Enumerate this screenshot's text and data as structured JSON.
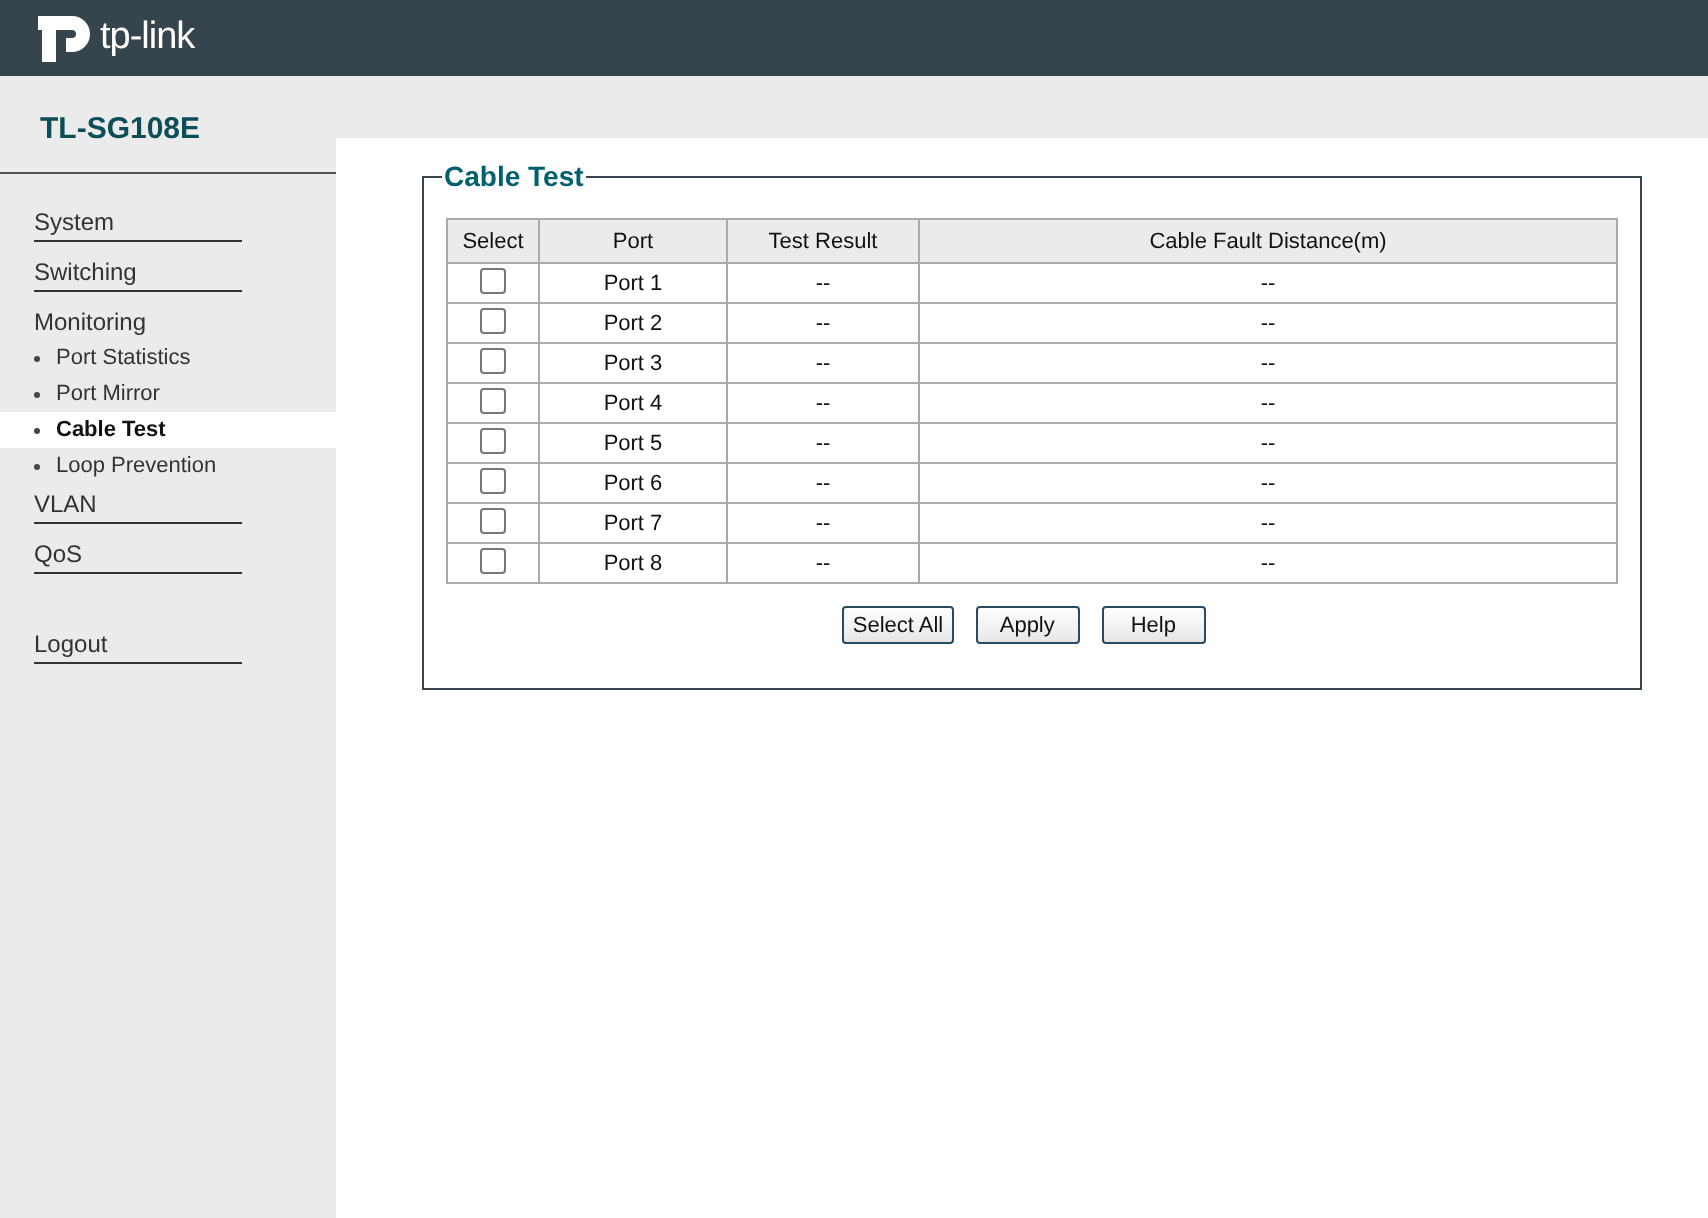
{
  "brand": "tp-link",
  "model": "TL-SG108E",
  "menu": [
    {
      "label": "System",
      "selected": false
    },
    {
      "label": "Switching",
      "selected": false
    },
    {
      "label": "Monitoring",
      "selected": false,
      "children": [
        {
          "label": "Port Statistics",
          "selected": false
        },
        {
          "label": "Port Mirror",
          "selected": false
        },
        {
          "label": "Cable Test",
          "selected": true
        },
        {
          "label": "Loop Prevention",
          "selected": false
        }
      ]
    },
    {
      "label": "VLAN",
      "selected": false
    },
    {
      "label": "QoS",
      "selected": false
    }
  ],
  "logout": "Logout",
  "panel": {
    "title": "Cable Test",
    "table": {
      "columns": [
        "Select",
        "Port",
        "Test Result",
        "Cable Fault Distance(m)"
      ],
      "rows": [
        {
          "checked": false,
          "port": "Port 1",
          "result": "--",
          "distance": "--"
        },
        {
          "checked": false,
          "port": "Port 2",
          "result": "--",
          "distance": "--"
        },
        {
          "checked": false,
          "port": "Port 3",
          "result": "--",
          "distance": "--"
        },
        {
          "checked": false,
          "port": "Port 4",
          "result": "--",
          "distance": "--"
        },
        {
          "checked": false,
          "port": "Port 5",
          "result": "--",
          "distance": "--"
        },
        {
          "checked": false,
          "port": "Port 6",
          "result": "--",
          "distance": "--"
        },
        {
          "checked": false,
          "port": "Port 7",
          "result": "--",
          "distance": "--"
        },
        {
          "checked": false,
          "port": "Port 8",
          "result": "--",
          "distance": "--"
        }
      ]
    },
    "buttons": [
      "Select All",
      "Apply",
      "Help"
    ]
  }
}
